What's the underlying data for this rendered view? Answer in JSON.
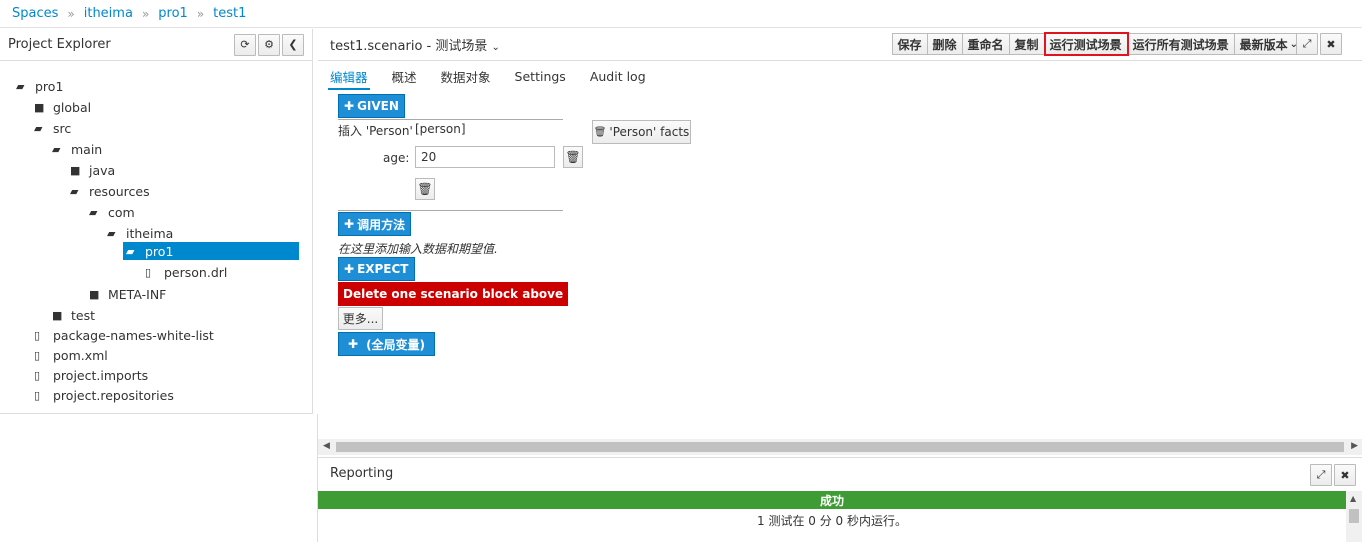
{
  "breadcrumb": [
    "Spaces",
    "itheima",
    "pro1",
    "test1"
  ],
  "explorer": {
    "title": "Project Explorer",
    "tree": [
      {
        "label": "pro1",
        "icon": "folder-open-icon"
      },
      {
        "label": "global",
        "icon": "folder-icon"
      },
      {
        "label": "src",
        "icon": "folder-open-icon"
      },
      {
        "label": "main",
        "icon": "folder-open-icon"
      },
      {
        "label": "java",
        "icon": "folder-icon"
      },
      {
        "label": "resources",
        "icon": "folder-open-icon"
      },
      {
        "label": "com",
        "icon": "folder-open-icon"
      },
      {
        "label": "itheima",
        "icon": "folder-open-icon"
      },
      {
        "label": "pro1",
        "icon": "folder-open-icon",
        "selected": true
      },
      {
        "label": "person.drl",
        "icon": "file-icon"
      },
      {
        "label": "META-INF",
        "icon": "folder-icon"
      },
      {
        "label": "test",
        "icon": "folder-icon"
      },
      {
        "label": "package-names-white-list",
        "icon": "file-icon"
      },
      {
        "label": "pom.xml",
        "icon": "file-icon"
      },
      {
        "label": "project.imports",
        "icon": "file-icon"
      },
      {
        "label": "project.repositories",
        "icon": "file-icon"
      }
    ]
  },
  "editor": {
    "title": "test1.scenario - 测试场景",
    "toolbar": [
      "保存",
      "删除",
      "重命名",
      "复制",
      "运行测试场景",
      "运行所有测试场景",
      "最新版本"
    ],
    "tabs": [
      "编辑器",
      "概述",
      "数据对象",
      "Settings",
      "Audit log"
    ],
    "given_label": "GIVEN",
    "insert_label": "插入 'Person'",
    "insert_var": "[person]",
    "age_label": "age:",
    "age_value": "20",
    "facts_label": "'Person' facts",
    "call_method_label": "调用方法",
    "hint": "在这里添加输入数据和期望值.",
    "expect_label": "EXPECT",
    "delete_block_label": "Delete one scenario block above",
    "more_label": "更多...",
    "globals_label": "(全局变量)"
  },
  "reporting": {
    "title": "Reporting",
    "status": "成功",
    "message": "1 测试在 0 分 0 秒内运行。"
  },
  "colors": {
    "accent": "#0088ce",
    "success": "#3f9c35",
    "danger": "#cc0000",
    "highlight": "#e0141e"
  }
}
